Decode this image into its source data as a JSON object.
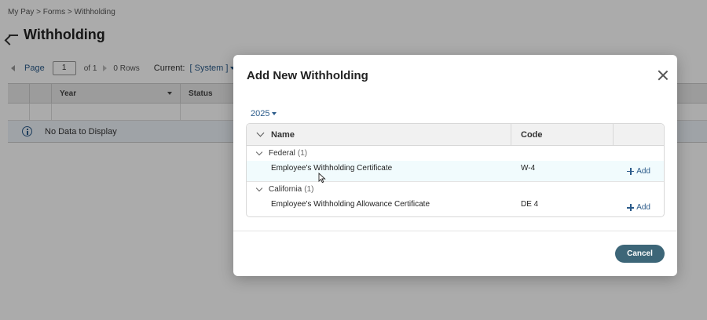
{
  "breadcrumb": {
    "items": [
      "My Pay",
      ">",
      "Forms",
      ">",
      "Withholding"
    ]
  },
  "page": {
    "title": "Withholding"
  },
  "pager": {
    "page_label": "Page",
    "page_value": "1",
    "of_label": "of 1",
    "rows_label": "0 Rows",
    "current_label": "Current:",
    "current_value": "[ System ]"
  },
  "grid": {
    "columns": [
      "Year",
      "Status"
    ],
    "empty_message": "No Data to Display"
  },
  "modal": {
    "title": "Add New Withholding",
    "year": "2025",
    "table": {
      "columns": {
        "name": "Name",
        "code": "Code"
      },
      "groups": [
        {
          "name": "Federal",
          "count": "(1)",
          "items": [
            {
              "name": "Employee's Withholding Certificate",
              "code": "W-4",
              "action": "Add"
            }
          ]
        },
        {
          "name": "California",
          "count": "(1)",
          "items": [
            {
              "name": "Employee's Withholding Allowance Certificate",
              "code": "DE 4",
              "action": "Add"
            }
          ]
        }
      ]
    },
    "cancel_label": "Cancel"
  },
  "colors": {
    "accent": "#2b5b8a",
    "cancel_button": "#3d6678",
    "row_highlight": "#f1fbfd",
    "overlay": "rgba(0,0,0,0.33)"
  }
}
